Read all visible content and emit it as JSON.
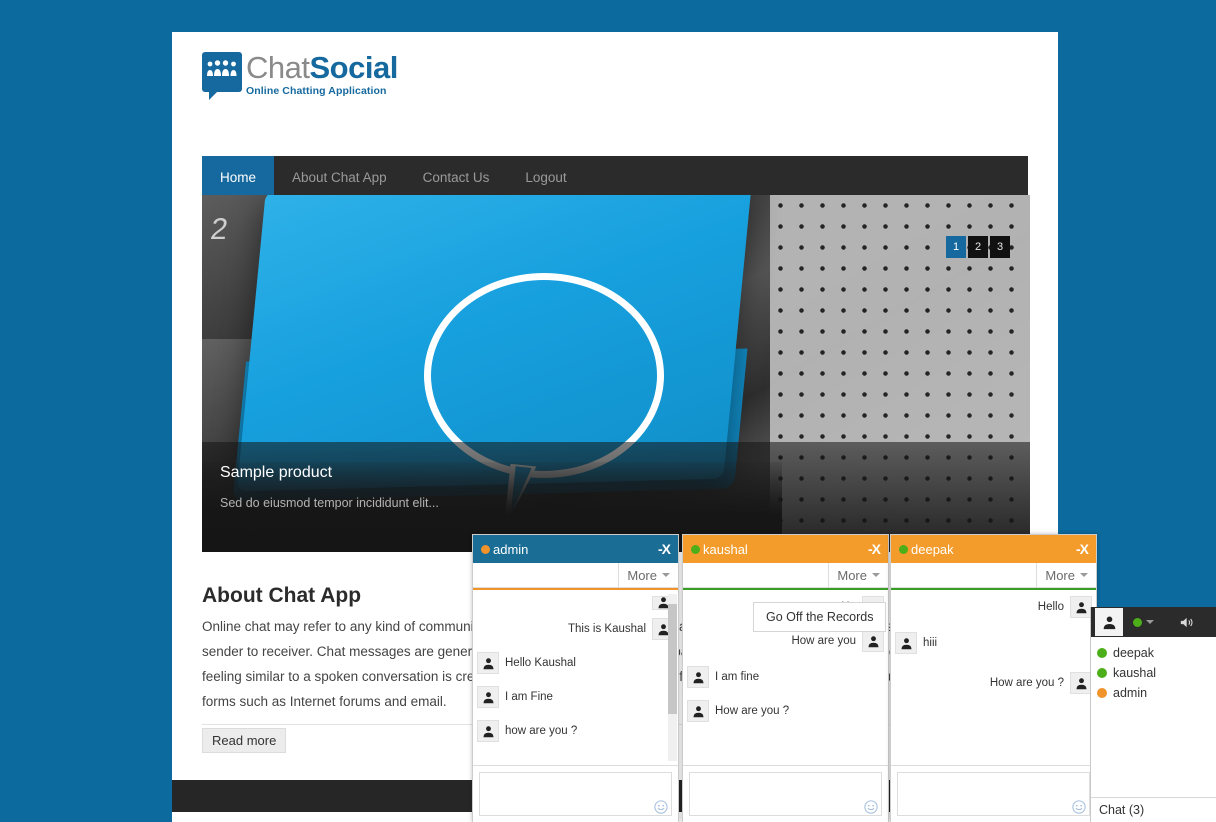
{
  "brand": {
    "title_part1": "Chat",
    "title_part2": "Social",
    "tagline": "Online Chatting Application",
    "accent": "#16699e"
  },
  "nav": {
    "items": [
      {
        "label": "Home",
        "active": true
      },
      {
        "label": "About Chat App",
        "active": false
      },
      {
        "label": "Contact Us",
        "active": false
      },
      {
        "label": "Logout",
        "active": false
      }
    ]
  },
  "carousel": {
    "caption_title": "Sample product",
    "caption_text": "Sed do eiusmod tempor incididunt elit...",
    "indicators": [
      "1",
      "2",
      "3"
    ],
    "active_indicator": "1",
    "key_label": "2"
  },
  "about": {
    "heading": "About Chat App",
    "body": "Online chat may refer to any kind of communication over the Internet that offers a real-time transmission of text messages from sender to receiver. Chat messages are generally short in order to enable other participants to respond quickly. Thereby, a feeling similar to a spoken conversation is created, which distinguishes chatting from other text-based online communication forms such as Internet forums and email.",
    "read_more_label": "Read more"
  },
  "chat_windows": [
    {
      "user": "admin",
      "status_color": "#f0932b",
      "header_bg": "#1a6d95",
      "accent_color": "#f0932b",
      "more_label": "More",
      "close_label": "-X",
      "has_scrollbar": true,
      "tooltip": null,
      "messages": [
        {
          "side": "right",
          "text": ""
        },
        {
          "side": "right",
          "text": "This is Kaushal"
        },
        {
          "side": "left",
          "text": "Hello Kaushal"
        },
        {
          "side": "left",
          "text": "I am Fine"
        },
        {
          "side": "left",
          "text": "how are you ?"
        }
      ]
    },
    {
      "user": "kaushal",
      "status_color": "#4caf1a",
      "header_bg": "#f39c2b",
      "accent_color": "#4caf1a",
      "more_label": "More",
      "close_label": "-X",
      "has_scrollbar": false,
      "tooltip": "Go Off the Records",
      "messages": [
        {
          "side": "right",
          "text": "Hu"
        },
        {
          "side": "right",
          "text": "How are you"
        },
        {
          "side": "left",
          "text": "I am fine"
        },
        {
          "side": "left",
          "text": "How are you ?"
        }
      ]
    },
    {
      "user": "deepak",
      "status_color": "#4caf1a",
      "header_bg": "#f39c2b",
      "accent_color": "#4caf1a",
      "more_label": "More",
      "close_label": "-X",
      "has_scrollbar": false,
      "tooltip": null,
      "messages": [
        {
          "side": "right",
          "text": "Hello"
        },
        {
          "side": "left",
          "text": "hiii"
        },
        {
          "side": "right",
          "text": "How are you ?"
        }
      ]
    }
  ],
  "roster": {
    "status_color": "#4caf1a",
    "items": [
      {
        "name": "deepak",
        "color": "#4caf1a"
      },
      {
        "name": "kaushal",
        "color": "#4caf1a"
      },
      {
        "name": "admin",
        "color": "#f0932b"
      }
    ],
    "footer_label": "Chat (3)"
  }
}
